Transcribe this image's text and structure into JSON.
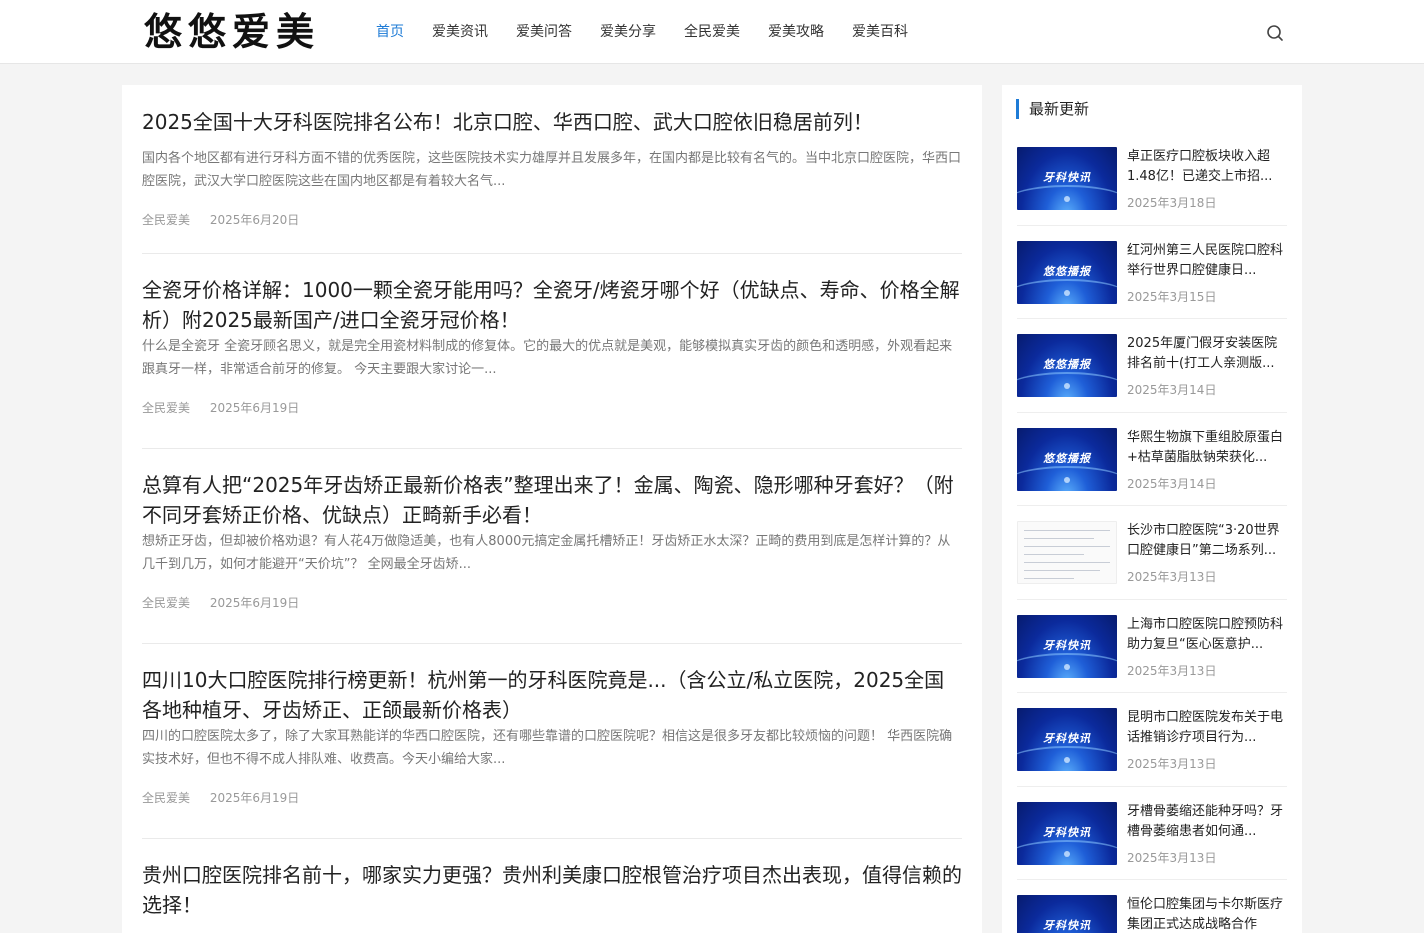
{
  "site": {
    "logo": "悠悠爱美"
  },
  "nav": {
    "items": [
      {
        "label": "首页",
        "active": true
      },
      {
        "label": "爱美资讯",
        "active": false
      },
      {
        "label": "爱美问答",
        "active": false
      },
      {
        "label": "爱美分享",
        "active": false
      },
      {
        "label": "全民爱美",
        "active": false
      },
      {
        "label": "爱美攻略",
        "active": false
      },
      {
        "label": "爱美百科",
        "active": false
      }
    ],
    "search_icon": "search-icon",
    "accent_color": "#1e7bd6"
  },
  "articles": [
    {
      "title": "2025全国十大牙科医院排名公布！北京口腔、华西口腔、武大口腔依旧稳居前列！",
      "excerpt": "国内各个地区都有进行牙科方面不错的优秀医院，这些医院技术实力雄厚并且发展多年，在国内都是比较有名气的。当中北京口腔医院，华西口腔医院，武汉大学口腔医院这些在国内地区都是有着较大名气...",
      "category": "全民爱美",
      "date": "2025年6月20日"
    },
    {
      "title": "全瓷牙价格详解：1000一颗全瓷牙能用吗？全瓷牙/烤瓷牙哪个好（优缺点、寿命、价格全解析）附2025最新国产/进口全瓷牙冠价格！",
      "excerpt": "什么是全瓷牙 全瓷牙顾名思义，就是完全用瓷材料制成的修复体。它的最大的优点就是美观，能够模拟真实牙齿的颜色和透明感，外观看起来跟真牙一样，非常适合前牙的修复。 今天主要跟大家讨论一...",
      "category": "全民爱美",
      "date": "2025年6月19日"
    },
    {
      "title": "总算有人把“2025年牙齿矫正最新价格表”整理出来了！金属、陶瓷、隐形哪种牙套好？（附不同牙套矫正价格、优缺点）正畸新手必看！",
      "excerpt": "想矫正牙齿，但却被价格劝退？有人花4万做隐适美，也有人8000元搞定金属托槽矫正！牙齿矫正水太深？正畸的费用到底是怎样计算的？从几千到几万，如何才能避开“天价坑”？ 全网最全牙齿矫...",
      "category": "全民爱美",
      "date": "2025年6月19日"
    },
    {
      "title": "四川10大口腔医院排行榜更新！杭州第一的牙科医院竟是...（含公立/私立医院，2025全国各地种植牙、牙齿矫正、正颌最新价格表）",
      "excerpt": "四川的口腔医院太多了，除了大家耳熟能详的华西口腔医院，还有哪些靠谱的口腔医院呢？相信这是很多牙友都比较烦恼的问题！ 华西医院确实技术好，但也不得不成人排队难、收费高。今天小编给大家...",
      "category": "全民爱美",
      "date": "2025年6月19日"
    },
    {
      "title": "贵州口腔医院排名前十，哪家实力更强？贵州利美康口腔根管治疗项目杰出表现，值得信赖的选择！",
      "excerpt": "",
      "category": "",
      "date": ""
    }
  ],
  "sidebar": {
    "title": "最新更新",
    "items": [
      {
        "title": "卓正医疗口腔板块收入超1.48亿！已递交上市招...",
        "date": "2025年3月18日",
        "thumb": "牙科快讯",
        "thumb_type": "banner"
      },
      {
        "title": "红河州第三人民医院口腔科举行世界口腔健康日...",
        "date": "2025年3月15日",
        "thumb": "悠悠播报",
        "thumb_type": "banner"
      },
      {
        "title": "2025年厦门假牙安装医院排名前十(打工人亲测版...",
        "date": "2025年3月14日",
        "thumb": "悠悠播报",
        "thumb_type": "banner"
      },
      {
        "title": "华熙生物旗下重组胶原蛋白+枯草菌脂肽钠荣获化...",
        "date": "2025年3月14日",
        "thumb": "悠悠播报",
        "thumb_type": "banner"
      },
      {
        "title": "长沙市口腔医院“3·20世界口腔健康日”第二场系列...",
        "date": "2025年3月13日",
        "thumb": "",
        "thumb_type": "document"
      },
      {
        "title": "上海市口腔医院口腔预防科助力复旦“医心医意护...",
        "date": "2025年3月13日",
        "thumb": "牙科快讯",
        "thumb_type": "banner"
      },
      {
        "title": "昆明市口腔医院发布关于电话推销诊疗项目行为...",
        "date": "2025年3月13日",
        "thumb": "牙科快讯",
        "thumb_type": "banner"
      },
      {
        "title": "牙槽骨萎缩还能种牙吗？牙槽骨萎缩患者如何通...",
        "date": "2025年3月13日",
        "thumb": "牙科快讯",
        "thumb_type": "banner"
      },
      {
        "title": "恒伦口腔集团与卡尔斯医疗集团正式达成战略合作",
        "date": "",
        "thumb": "牙科快讯",
        "thumb_type": "banner"
      }
    ]
  }
}
